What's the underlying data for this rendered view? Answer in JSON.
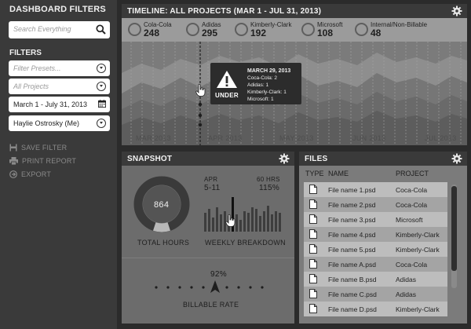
{
  "sidebar": {
    "title": "DASHBOARD FILTERS",
    "search_placeholder": "Search Everything",
    "filters_heading": "FILTERS",
    "presets_placeholder": "Filter Presets...",
    "projects_placeholder": "All Projects",
    "date_range": "March 1 - July 31, 2013",
    "user": "Haylie Ostrosky (Me)",
    "actions": [
      {
        "label": "SAVE FILTER",
        "icon": "save-icon"
      },
      {
        "label": "PRINT REPORT",
        "icon": "print-icon"
      },
      {
        "label": "EXPORT",
        "icon": "export-icon"
      }
    ]
  },
  "timeline": {
    "title": "TIMELINE: ALL PROJECTS (MAR 1 - JUL 31, 2013)",
    "stats": [
      {
        "name": "Cola-Cola",
        "value": "248"
      },
      {
        "name": "Adidas",
        "value": "295"
      },
      {
        "name": "Kimberly-Clark",
        "value": "192"
      },
      {
        "name": "Microsoft",
        "value": "108"
      },
      {
        "name": "Internal/Non-Billable",
        "value": "48"
      }
    ],
    "months": [
      "MAR 2013",
      "APR 2013",
      "MAY 2013",
      "JUN 2013",
      "JUL 2013"
    ],
    "tooltip": {
      "status": "UNDER",
      "date": "MARCH 29, 2013",
      "lines": [
        "Coca-Cola: 2",
        "Adidas: 1",
        "Kimberly-Clark: 1",
        "Microsoft: 1"
      ]
    }
  },
  "snapshot": {
    "title": "SNAPSHOT",
    "total_hours": "864",
    "total_hours_label": "TOTAL HOURS",
    "week_month": "APR",
    "week_days": "5-11",
    "hours_target": "60 HRS",
    "hours_pct": "115%",
    "weekly_label": "WEEKLY BREAKDOWN",
    "billable_pct": "92%",
    "billable_label": "BILLABLE RATE",
    "weekly_breakdown_levels": [
      0.55,
      0.65,
      0.4,
      0.7,
      0.5,
      0.6,
      0.45,
      1.0,
      0.5,
      0.35,
      0.6,
      0.55,
      0.7,
      0.65,
      0.45,
      0.6,
      0.75,
      0.5,
      0.6,
      0.55
    ],
    "highlight_bar_index": 7,
    "donut_fraction": 0.9
  },
  "files": {
    "title": "FILES",
    "headers": [
      "TYPE",
      "NAME",
      "PROJECT"
    ],
    "rows": [
      {
        "name": "File name 1.psd",
        "project": "Coca-Cola"
      },
      {
        "name": "File name 2.psd",
        "project": "Coca-Cola"
      },
      {
        "name": "File name 3.psd",
        "project": "Microsoft"
      },
      {
        "name": "File name 4.psd",
        "project": "Kimberly-Clark"
      },
      {
        "name": "File name 5.psd",
        "project": "Kimberly-Clark"
      },
      {
        "name": "File name A.psd",
        "project": "Coca-Cola"
      },
      {
        "name": "File name B.psd",
        "project": "Adidas"
      },
      {
        "name": "File name C.psd",
        "project": "Adidas"
      },
      {
        "name": "File name D.psd",
        "project": "Kimberly-Clark"
      }
    ]
  },
  "colors": {
    "sidebar_bg": "#3a3a3a",
    "panel_header_bg": "#3a3a3a",
    "timeline_bg": "#7b7b7b",
    "stats_bg": "#9b9b9b",
    "tooltip_bg": "#2c2c2c"
  }
}
